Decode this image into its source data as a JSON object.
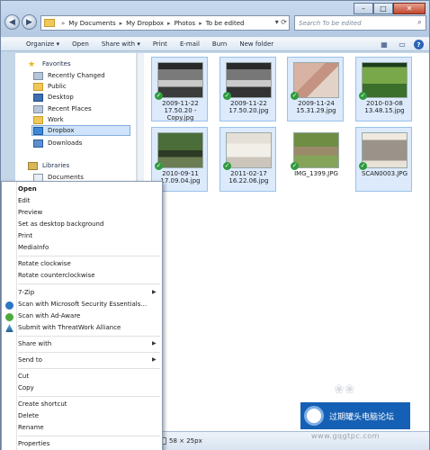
{
  "address": {
    "crumbs": [
      "My Documents",
      "My Dropbox",
      "Photos",
      "To be edited"
    ],
    "search_placeholder": "Search To be edited"
  },
  "toolbar": {
    "organize": "Organize ▾",
    "open": "Open",
    "share": "Share with ▾",
    "print": "Print",
    "email": "E-mail",
    "burn": "Burn",
    "new_folder": "New folder"
  },
  "sidebar": {
    "favorites": "Favorites",
    "items": [
      "Recently Changed",
      "Public",
      "Desktop",
      "Recent Places",
      "Work",
      "Dropbox",
      "Downloads"
    ],
    "libraries": "Libraries",
    "lib_items": [
      "Documents"
    ]
  },
  "files": [
    {
      "line1": "2009-11-22",
      "line2": "17.50.20 -",
      "line3": "Copy.jpg"
    },
    {
      "line1": "2009-11-22",
      "line2": "17.50.20.jpg",
      "line3": ""
    },
    {
      "line1": "2009-11-24",
      "line2": "15.31.29.jpg",
      "line3": ""
    },
    {
      "line1": "2010-03-08",
      "line2": "13.48.15.jpg",
      "line3": ""
    },
    {
      "line1": "2010-09-11",
      "line2": "17.09.04.jpg",
      "line3": ""
    },
    {
      "line1": "2011-02-17",
      "line2": "16.22.06.jpg",
      "line3": ""
    },
    {
      "line1": "IMG_1399.JPG",
      "line2": "",
      "line3": ""
    },
    {
      "line1": "SCAN0003.JPG",
      "line2": "",
      "line3": ""
    }
  ],
  "context_menu": {
    "open": "Open",
    "edit": "Edit",
    "preview": "Preview",
    "set_desktop": "Set as desktop background",
    "print": "Print",
    "mediainfo": "MediaInfo",
    "rotate_cw": "Rotate clockwise",
    "rotate_ccw": "Rotate counterclockwise",
    "zip": "7-Zip",
    "scan_mse": "Scan with Microsoft Security Essentials...",
    "scan_adaware": "Scan with Ad-Aware",
    "threatwork": "Submit with ThreatWork Alliance",
    "share_with": "Share with",
    "send_to": "Send to",
    "cut": "Cut",
    "copy": "Copy",
    "create_shortcut": "Create shortcut",
    "delete": "Delete",
    "rename": "Rename",
    "properties": "Properties"
  },
  "status": {
    "dims": "58 × 25px"
  },
  "watermark": {
    "text": "过期罐头电脑论坛",
    "url": "www.gqgtpc.com"
  }
}
